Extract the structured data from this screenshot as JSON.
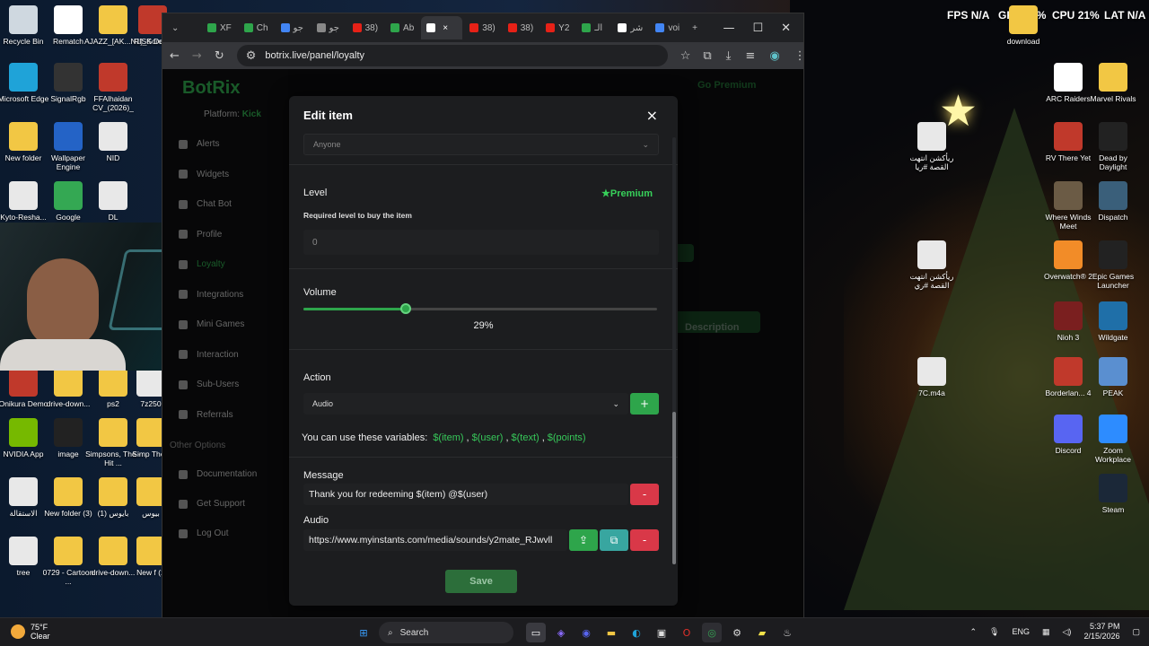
{
  "desktop": {
    "left_icons": [
      {
        "label": "Recycle Bin",
        "icon": "recycle-bin-icon",
        "color": "#cfd8e0"
      },
      {
        "label": "Rematch",
        "icon": "document-icon",
        "color": "#ffffff"
      },
      {
        "label": "AJAZZ_[AK...N1]_Screen...",
        "icon": "folder-icon",
        "color": "#f2c744"
      },
      {
        "label": "RISK Domi",
        "icon": "game-icon",
        "color": "#c0392b"
      },
      {
        "label": "Microsoft Edge",
        "icon": "edge-icon",
        "color": "#1fa3d8"
      },
      {
        "label": "SignalRgb",
        "icon": "signalrgb-icon",
        "color": "#333333"
      },
      {
        "label": "FFAlhaidan CV_(2026)_",
        "icon": "pdf-icon",
        "color": "#c0392b"
      },
      {
        "label": "New folder",
        "icon": "folder-icon",
        "color": "#f2c744"
      },
      {
        "label": "Wallpaper Engine",
        "icon": "wallpaper-engine-icon",
        "color": "#2463c6"
      },
      {
        "label": "NID",
        "icon": "document-icon",
        "color": "#e8e8e8"
      },
      {
        "label": "Kyto-Resha...",
        "icon": "gear-icon",
        "color": "#e8e8e8"
      },
      {
        "label": "Google",
        "icon": "chrome-icon",
        "color": "#34a853"
      },
      {
        "label": "DL",
        "icon": "document-icon",
        "color": "#e8e8e8"
      },
      {
        "label": "Onikura Demo",
        "icon": "game-icon",
        "color": "#c0392b"
      },
      {
        "label": "drive-down...",
        "icon": "folder-icon",
        "color": "#f2c744"
      },
      {
        "label": "ps2",
        "icon": "folder-icon",
        "color": "#f2c744"
      },
      {
        "label": "7z250",
        "icon": "archive-icon",
        "color": "#e8e8e8"
      },
      {
        "label": "NVIDIA App",
        "icon": "nvidia-icon",
        "color": "#76b900"
      },
      {
        "label": "image",
        "icon": "image-icon",
        "color": "#222222"
      },
      {
        "label": "Simpsons, The - Hit ...",
        "icon": "folder-icon",
        "color": "#f2c744"
      },
      {
        "label": "Simp The -",
        "icon": "folder-icon",
        "color": "#f2c744"
      },
      {
        "label": "الاستقالة",
        "icon": "document-icon",
        "color": "#e8e8e8"
      },
      {
        "label": "New folder (3)",
        "icon": "folder-icon",
        "color": "#f2c744"
      },
      {
        "label": "بايوس (1)",
        "icon": "folder-icon",
        "color": "#f2c744"
      },
      {
        "label": "بيوس",
        "icon": "folder-icon",
        "color": "#f2c744"
      },
      {
        "label": "tree",
        "icon": "image-icon",
        "color": "#e8e8e8"
      },
      {
        "label": "0729 - Cartoon ...",
        "icon": "folder-icon",
        "color": "#f2c744"
      },
      {
        "label": "drive-down...",
        "icon": "folder-icon",
        "color": "#f2c744"
      },
      {
        "label": "New f (2",
        "icon": "folder-icon",
        "color": "#f2c744"
      }
    ],
    "right_icons": [
      {
        "label": "download",
        "icon": "folder-icon",
        "color": "#f2c744"
      },
      {
        "label": "ARC Raiders",
        "icon": "arc-raiders-icon",
        "color": "#ffffff"
      },
      {
        "label": "Marvel Rivals",
        "icon": "marvel-rivals-icon",
        "color": "#f2c744"
      },
      {
        "label": "ريأكشن انتهت القصة #ريا",
        "icon": "video-icon",
        "color": "#e8e8e8"
      },
      {
        "label": "RV There Yet",
        "icon": "game-icon",
        "color": "#c0392b"
      },
      {
        "label": "Dead by Daylight",
        "icon": "game-icon",
        "color": "#222222"
      },
      {
        "label": "Where Winds Meet",
        "icon": "game-icon",
        "color": "#6b5b45"
      },
      {
        "label": "Dispatch",
        "icon": "game-icon",
        "color": "#3a5f7a"
      },
      {
        "label": "ريأكشن انتهت القصة #ري",
        "icon": "video-icon",
        "color": "#e8e8e8"
      },
      {
        "label": "Overwatch® 2",
        "icon": "overwatch-icon",
        "color": "#f28c28"
      },
      {
        "label": "Epic Games Launcher",
        "icon": "epic-icon",
        "color": "#222222"
      },
      {
        "label": "Nioh 3",
        "icon": "game-icon",
        "color": "#7a1f1f"
      },
      {
        "label": "Wildgate",
        "icon": "game-icon",
        "color": "#1f6fa8"
      },
      {
        "label": "7C.m4a",
        "icon": "audio-icon",
        "color": "#e8e8e8"
      },
      {
        "label": "Borderlan... 4",
        "icon": "game-icon",
        "color": "#c0392b"
      },
      {
        "label": "PEAK",
        "icon": "game-icon",
        "color": "#5a8fd0"
      },
      {
        "label": "Discord",
        "icon": "discord-icon",
        "color": "#5865f2"
      },
      {
        "label": "Zoom Workplace",
        "icon": "zoom-icon",
        "color": "#2d8cff"
      },
      {
        "label": "Steam",
        "icon": "steam-icon",
        "color": "#1b2838"
      }
    ]
  },
  "osd": {
    "fps_label": "FPS",
    "fps_value": "N/A",
    "gpu_label": "GPU",
    "gpu_value": "53",
    "gpu_unit": "%",
    "cpu_label": "CPU",
    "cpu_value": "21",
    "cpu_unit": "%",
    "lat_label": "LAT",
    "lat_value": "N/A"
  },
  "browser": {
    "tabs": [
      {
        "label": "XF",
        "color": "#2ea54b"
      },
      {
        "label": "Ch",
        "color": "#2ea54b"
      },
      {
        "label": "جو",
        "color": "#4285f4"
      },
      {
        "label": "جو",
        "color": "#888888"
      },
      {
        "label": "38)",
        "color": "#e62117"
      },
      {
        "label": "Ab",
        "color": "#2ea54b"
      },
      {
        "label": "",
        "color": "#ffffff"
      },
      {
        "label": "38)",
        "color": "#e62117"
      },
      {
        "label": "38)",
        "color": "#e62117"
      },
      {
        "label": "Y2",
        "color": "#e62117"
      },
      {
        "label": "الـ",
        "color": "#2ea54b"
      },
      {
        "label": "شر",
        "color": "#ffffff"
      },
      {
        "label": "voi",
        "color": "#4285f4"
      }
    ],
    "url": "botrix.live/panel/loyalty"
  },
  "site": {
    "brand": "BotRix",
    "platform_label": "Platform:",
    "platform_value": "Kick",
    "go_premium": "Go Premium",
    "nav": [
      "Alerts",
      "Widgets",
      "Chat Bot",
      "Profile",
      "Loyalty",
      "Integrations",
      "Mini Games",
      "Interaction",
      "Sub-Users",
      "Referrals"
    ],
    "other_options": "Other Options",
    "other_nav": [
      "Documentation",
      "Get Support",
      "Log Out"
    ],
    "bg_description": "Description"
  },
  "modal": {
    "title": "Edit item",
    "close_glyph": "×",
    "who_select": "Anyone",
    "level_label": "Level",
    "premium_badge": "Premium",
    "level_hint": "Required level to buy the item",
    "level_placeholder": "0",
    "volume_label": "Volume",
    "volume_percent": 29,
    "volume_text": "29%",
    "action_label": "Action",
    "action_value": "Audio",
    "add_glyph": "+",
    "vars_prefix": "You can use these variables:",
    "vars": [
      "$(item)",
      "$(user)",
      "$(text)",
      "$(points)"
    ],
    "message_label": "Message",
    "message_value": "Thank you for redeeming $(item) @$(user)",
    "remove_glyph": "-",
    "audio_label": "Audio",
    "audio_value": "https://www.myinstants.com/media/sounds/y2mate_RJwvll",
    "save_label": "Save"
  },
  "taskbar": {
    "temp": "75°F",
    "weather": "Clear",
    "search_label": "Search",
    "lang": "ENG",
    "time": "5:37 PM",
    "date": "2/15/2026"
  },
  "colors": {
    "accent": "#2ea54b",
    "danger": "#d93848",
    "teal": "#38a6a0"
  }
}
